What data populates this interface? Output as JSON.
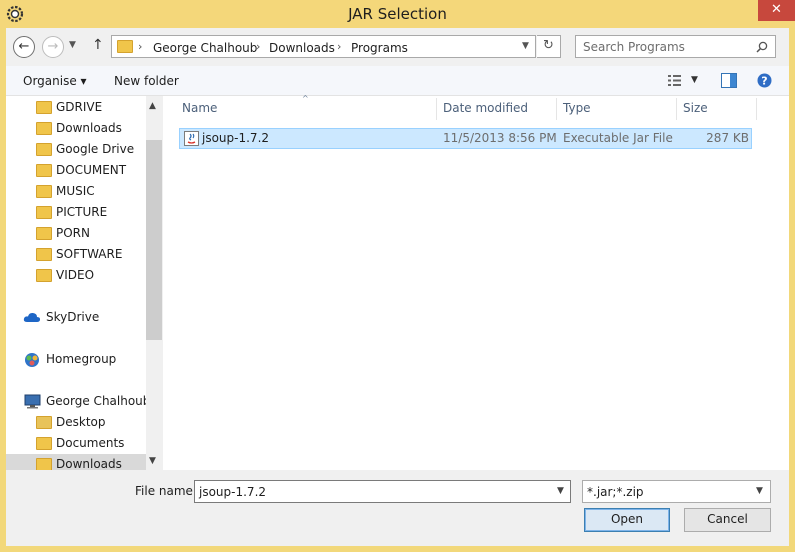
{
  "window": {
    "title": "JAR Selection",
    "close_glyph": "✕"
  },
  "address_bar": {
    "breadcrumbs": [
      "George Chalhoub",
      "Downloads",
      "Programs"
    ],
    "search_placeholder": "Search Programs"
  },
  "toolbar": {
    "organise_label": "Organise ▾",
    "new_folder_label": "New folder"
  },
  "nav_pane": {
    "folders": [
      "GDRIVE",
      "Downloads",
      "Google Drive",
      "DOCUMENT",
      "MUSIC",
      "PICTURE",
      "PORN",
      "SOFTWARE",
      "VIDEO"
    ],
    "skydrive": "SkyDrive",
    "homegroup": "Homegroup",
    "computer": "George Chalhoub",
    "computer_children": [
      "Desktop",
      "Documents",
      "Downloads"
    ]
  },
  "list": {
    "columns": {
      "name": "Name",
      "date": "Date modified",
      "type": "Type",
      "size": "Size"
    },
    "rows": [
      {
        "name": "jsoup-1.7.2",
        "date": "11/5/2013 8:56 PM",
        "type": "Executable Jar File",
        "size": "287 KB"
      }
    ]
  },
  "footer": {
    "file_name_label": "File name:",
    "file_name_value": "jsoup-1.7.2",
    "filter_value": "*.jar;*.zip",
    "open_label": "Open",
    "cancel_label": "Cancel"
  },
  "colors": {
    "titlebar": "#f4d77a",
    "close": "#c7483d",
    "selection": "#cce8ff",
    "folder": "#f0c54a"
  }
}
